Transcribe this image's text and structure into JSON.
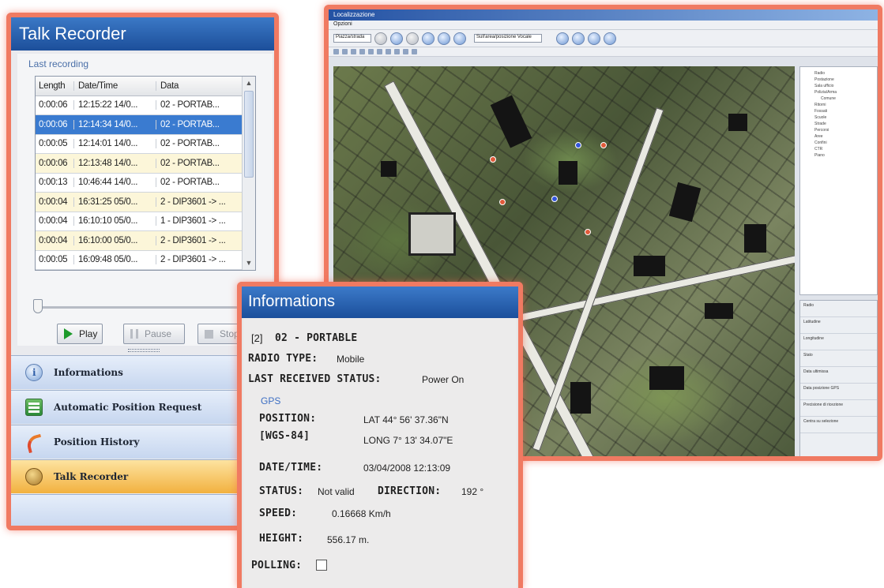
{
  "talk_recorder": {
    "title": "Talk Recorder",
    "section_label": "Last recording",
    "columns": [
      "Length",
      "Date/Time",
      "Data"
    ],
    "rows": [
      {
        "length": "0:00:06",
        "datetime": "12:15:22 14/0...",
        "data": "02 - PORTAB..."
      },
      {
        "length": "0:00:06",
        "datetime": "12:14:34 14/0...",
        "data": "02 - PORTAB..."
      },
      {
        "length": "0:00:05",
        "datetime": "12:14:01 14/0...",
        "data": "02 - PORTAB..."
      },
      {
        "length": "0:00:06",
        "datetime": "12:13:48 14/0...",
        "data": "02 - PORTAB..."
      },
      {
        "length": "0:00:13",
        "datetime": "10:46:44 14/0...",
        "data": "02 - PORTAB..."
      },
      {
        "length": "0:00:04",
        "datetime": "16:31:25 05/0...",
        "data": "2 - DIP3601 -> ..."
      },
      {
        "length": "0:00:04",
        "datetime": "16:10:10 05/0...",
        "data": "1 - DIP3601 -> ..."
      },
      {
        "length": "0:00:04",
        "datetime": "16:10:00 05/0...",
        "data": "2 - DIP3601 -> ..."
      },
      {
        "length": "0:00:05",
        "datetime": "16:09:48 05/0...",
        "data": "2 - DIP3601 -> ..."
      }
    ],
    "selected_row": 1,
    "playback_position": 0,
    "buttons": {
      "play": "Play",
      "pause": "Pause",
      "stop": "Stop"
    },
    "nav": {
      "informations": "Informations",
      "auto_position": "Automatic Position Request",
      "position_history": "Position History",
      "talk_recorder": "Talk Recorder"
    }
  },
  "map_app": {
    "title": "Localizzazione",
    "menu": "Opzioni",
    "toolbar_select_1": "Piazza/strada",
    "toolbar_select_2": "Sull'area/posizione Vocale",
    "layers": [
      "Radio",
      "Postazione",
      "Sala ufficio",
      "Polizia/Arma",
      "Comune",
      "Ritorni",
      "Fossati",
      "Scuole",
      "Strade",
      "Percorsi",
      "Aree",
      "Confini",
      "CTR",
      "Piano"
    ],
    "properties": [
      "Radio",
      "Latitudine",
      "Longitudine",
      "Stato",
      "Data ultimissa",
      "Data posizione GPS",
      "Precisione di ricezione",
      "Centra su selezione"
    ]
  },
  "informations": {
    "title": "Informations",
    "radio_id": "[2]",
    "radio_name": "02 - PORTABLE",
    "radio_type_label": "RADIO TYPE:",
    "radio_type": "Mobile",
    "last_status_label": "LAST RECEIVED STATUS:",
    "last_status": "Power On",
    "gps_label": "GPS",
    "position_label": "POSITION:",
    "datum_label": "[WGS-84]",
    "lat": "LAT 44° 56' 37.36\"N",
    "long": "LONG 7° 13' 34.07\"E",
    "datetime_label": "DATE/TIME:",
    "datetime": "03/04/2008 12:13:09",
    "status_label": "STATUS:",
    "status": "Not valid",
    "direction_label": "DIRECTION:",
    "direction": "192 °",
    "speed_label": "SPEED:",
    "speed": "0.16668 Km/h",
    "height_label": "HEIGHT:",
    "height": "556.17 m.",
    "polling_label": "POLLING:",
    "polling": false
  }
}
